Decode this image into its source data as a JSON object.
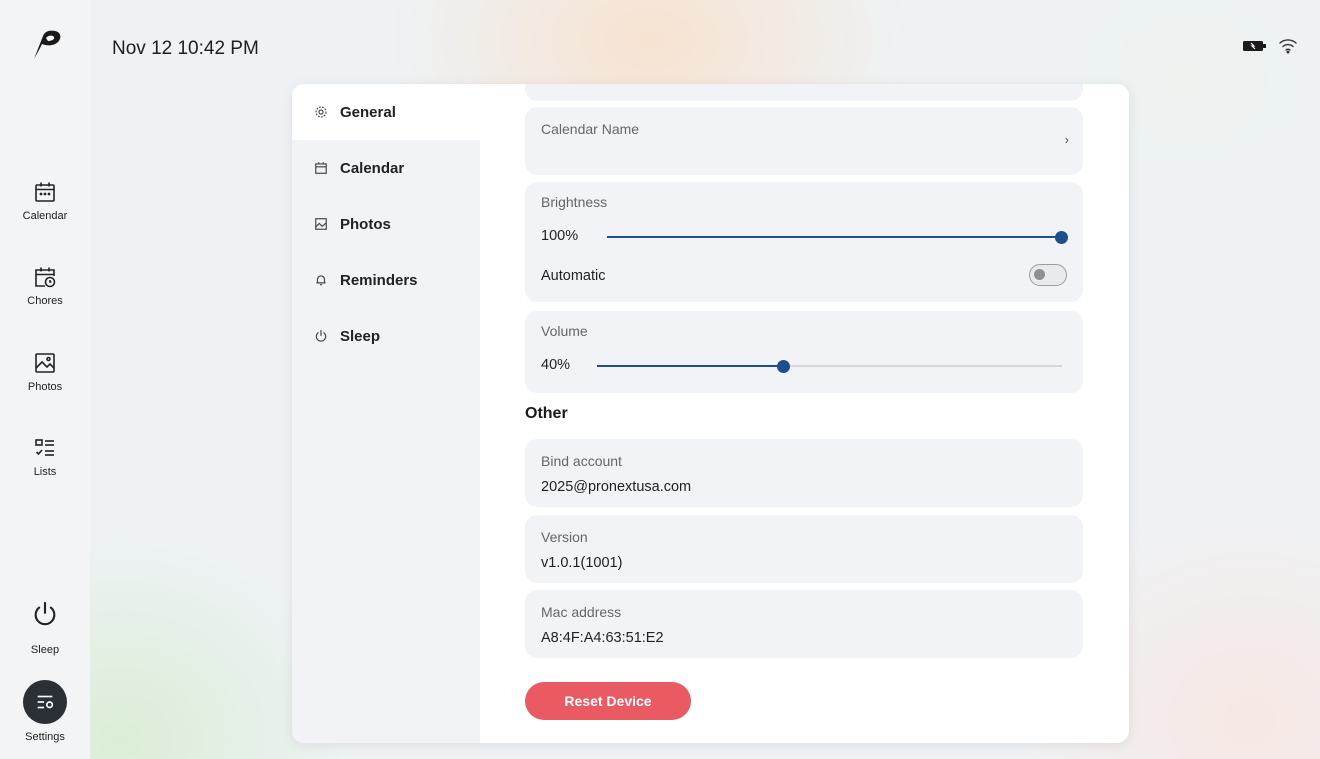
{
  "topbar": {
    "datetime": "Nov 12 10:42 PM"
  },
  "rail": {
    "items": [
      {
        "label": "Calendar",
        "icon": "calendar-icon"
      },
      {
        "label": "Chores",
        "icon": "chores-icon"
      },
      {
        "label": "Photos",
        "icon": "photos-icon"
      },
      {
        "label": "Lists",
        "icon": "lists-icon"
      }
    ],
    "sleep_label": "Sleep",
    "settings_label": "Settings"
  },
  "settings_nav": {
    "items": [
      {
        "label": "General",
        "icon": "gear-icon",
        "active": true
      },
      {
        "label": "Calendar",
        "icon": "calendar-icon",
        "active": false
      },
      {
        "label": "Photos",
        "icon": "image-icon",
        "active": false
      },
      {
        "label": "Reminders",
        "icon": "bell-icon",
        "active": false
      },
      {
        "label": "Sleep",
        "icon": "power-icon",
        "active": false
      }
    ]
  },
  "general": {
    "calendar_name_label": "Calendar Name",
    "brightness": {
      "label": "Brightness",
      "value_text": "100%",
      "value": 100
    },
    "automatic": {
      "label": "Automatic",
      "enabled": false
    },
    "volume": {
      "label": "Volume",
      "value_text": "40%",
      "value": 40
    },
    "other_title": "Other",
    "bind_account": {
      "label": "Bind account",
      "value": "2025@pronextusa.com"
    },
    "version": {
      "label": "Version",
      "value": "v1.0.1(1001)"
    },
    "mac_address": {
      "label": "Mac address",
      "value": "A8:4F:A4:63:51:E2"
    },
    "reset_button": "Reset Device"
  },
  "colors": {
    "accent": "#1f4e8f",
    "danger": "#e95a63",
    "card_bg": "#f2f3f6"
  }
}
